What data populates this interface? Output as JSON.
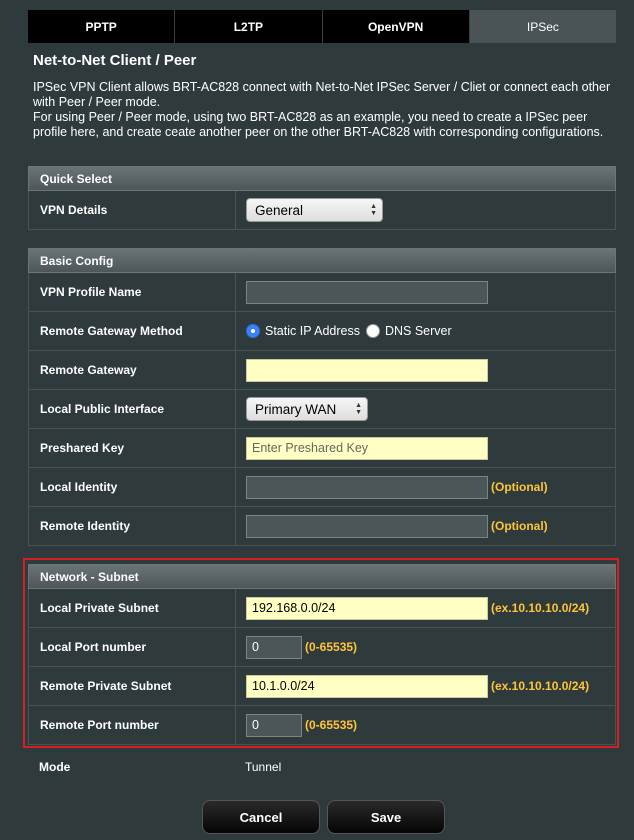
{
  "tabs": [
    "PPTP",
    "L2TP",
    "OpenVPN",
    "IPSec"
  ],
  "active_tab": "IPSec",
  "title": "Net-to-Net Client / Peer",
  "description": [
    "IPSec VPN Client allows BRT-AC828 connect with Net-to-Net IPSec Server / Cliet or connect each other with Peer / Peer mode.",
    "For using Peer / Peer mode, using two BRT-AC828 as an example, you need to create a IPSec peer profile here, and create ceate another peer on the other BRT-AC828 with corresponding configurations."
  ],
  "quick_select": {
    "header": "Quick Select",
    "vpn_details_label": "VPN Details",
    "vpn_details_value": "General"
  },
  "basic_config": {
    "header": "Basic Config",
    "profile_name_label": "VPN Profile Name",
    "profile_name_value": "",
    "gateway_method_label": "Remote Gateway Method",
    "gateway_method_options": [
      "Static IP Address",
      "DNS Server"
    ],
    "gateway_method_selected": "Static IP Address",
    "remote_gateway_label": "Remote Gateway",
    "remote_gateway_value": "",
    "local_interface_label": "Local Public Interface",
    "local_interface_value": "Primary WAN",
    "preshared_key_label": "Preshared Key",
    "preshared_key_placeholder": "Enter Preshared Key",
    "local_identity_label": "Local Identity",
    "local_identity_value": "",
    "remote_identity_label": "Remote Identity",
    "remote_identity_value": "",
    "optional_hint": "(Optional)"
  },
  "network_subnet": {
    "header": "Network - Subnet",
    "local_subnet_label": "Local Private Subnet",
    "local_subnet_value": "192.168.0.0/24",
    "local_port_label": "Local Port number",
    "local_port_value": "0",
    "remote_subnet_label": "Remote Private Subnet",
    "remote_subnet_value": "10.1.0.0/24",
    "remote_port_label": "Remote Port number",
    "remote_port_value": "0",
    "subnet_hint": "(ex.10.10.10.0/24)",
    "port_hint": "(0-65535)"
  },
  "mode": {
    "label": "Mode",
    "value": "Tunnel"
  },
  "buttons": {
    "cancel": "Cancel",
    "save": "Save"
  },
  "colors": {
    "highlight": "#d51f25",
    "hint": "#ffc43a",
    "radio_active": "#3b82f6"
  }
}
